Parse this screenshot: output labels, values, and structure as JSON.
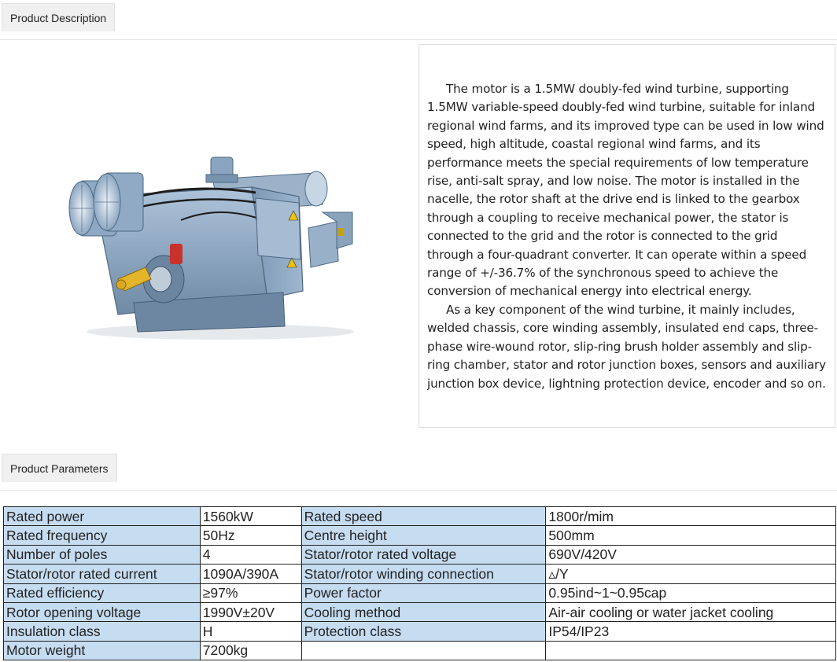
{
  "tabs": {
    "description": "Product Description",
    "parameters": "Product Parameters"
  },
  "description": {
    "paragraphs": [
      "The motor is a 1.5MW doubly-fed wind turbine, supporting 1.5MW variable-speed doubly-fed wind turbine, suitable for inland regional wind farms, and its improved type can be used in low wind speed, high altitude, coastal regional wind farms, and its performance meets the special requirements of low temperature rise, anti-salt spray, and low noise. The motor is installed in the nacelle, the rotor shaft at the drive end is linked to the gearbox through a coupling to receive mechanical power, the stator is connected to the grid and the rotor is connected to the grid through a four-quadrant converter. It can operate within a speed range of +/-36.7% of the synchronous speed to achieve the conversion of mechanical energy into electrical energy.",
      "As a key component of the wind turbine, it mainly includes, welded chassis, core winding assembly, insulated end caps, three-phase wire-wound rotor, slip-ring brush holder assembly and slip-ring chamber, stator and rotor junction boxes, sensors and auxiliary junction box device, lightning protection device, encoder and so on."
    ]
  },
  "colors": {
    "key_cell": "#c6dcf1",
    "motor_body": "#8fa9c4"
  },
  "parameters": [
    [
      "Rated power",
      "1560kW",
      "Rated speed",
      "1800r/mim"
    ],
    [
      "Rated frequency",
      "50Hz",
      "Centre height",
      "500mm"
    ],
    [
      "Number of poles",
      "4",
      "Stator/rotor rated voltage",
      "690V/420V"
    ],
    [
      "Stator/rotor rated current",
      "1090A/390A",
      "Stator/rotor winding connection",
      "▵/Y"
    ],
    [
      "Rated efficiency",
      "≥97%",
      "Power factor",
      "0.95ind~1~0.95cap"
    ],
    [
      "Rotor opening voltage",
      "1990V±20V",
      "Cooling method",
      "Air-air cooling or water jacket cooling"
    ],
    [
      "Insulation class",
      "H",
      "Protection class",
      "IP54/IP23"
    ],
    [
      "Motor weight",
      "7200kg",
      "",
      ""
    ]
  ]
}
